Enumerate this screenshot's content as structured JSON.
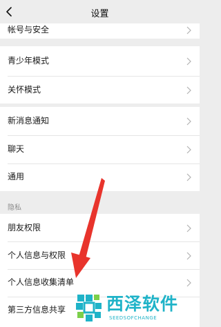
{
  "header": {
    "title": "设置"
  },
  "rows": {
    "account_security": "帐号与安全",
    "teen_mode": "青少年模式",
    "care_mode": "关怀模式",
    "new_message_notification": "新消息通知",
    "chat": "聊天",
    "general": "通用",
    "friend_permissions": "朋友权限",
    "personal_info_permissions": "个人信息与权限",
    "personal_info_collection_list": "个人信息收集清单",
    "third_party_sharing": "第三方信息共享"
  },
  "sections": {
    "privacy": "隐私"
  },
  "annotation": {
    "arrow_color": "#e8342c"
  },
  "watermark": {
    "title": "西泽软件",
    "subtitle": "SEEDSOFCHANGE",
    "color": "#1fb3c8"
  },
  "icons": {
    "back": "chevron-left-icon",
    "row_chevron": "chevron-right-icon"
  }
}
